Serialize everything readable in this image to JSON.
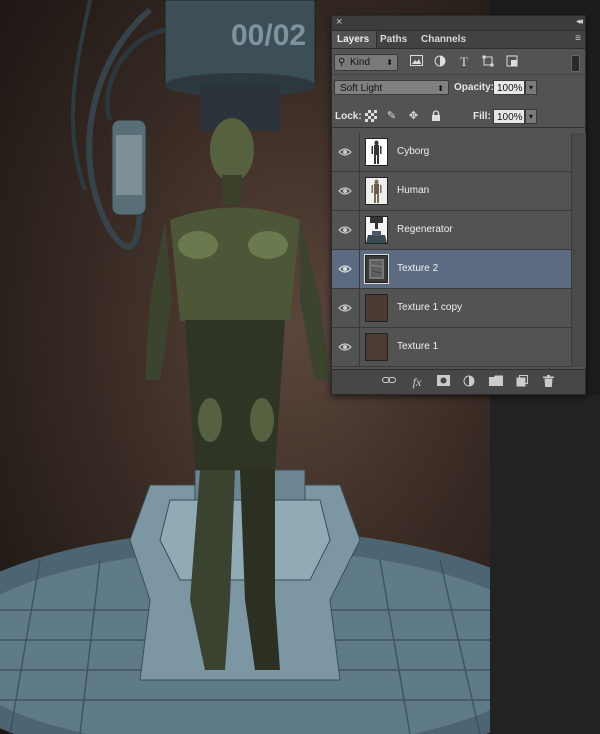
{
  "artwork": {
    "tank_label": "00/02"
  },
  "panel": {
    "close_glyph": "×",
    "collapse_glyph": "◂◂",
    "tabs": [
      {
        "label": "Layers",
        "active": true
      },
      {
        "label": "Paths",
        "active": false
      },
      {
        "label": "Channels",
        "active": false
      }
    ],
    "menu_glyph": "≡",
    "filter": {
      "kind_label": "Kind",
      "icons": [
        "image-filter-icon",
        "adjustment-filter-icon",
        "type-filter-icon",
        "shape-filter-icon",
        "smart-object-filter-icon"
      ]
    },
    "blend_mode": "Soft Light",
    "opacity_label": "Opacity:",
    "opacity_value": "100%",
    "lock_label": "Lock:",
    "fill_label": "Fill:",
    "fill_value": "100%",
    "layers": [
      {
        "name": "Cyborg",
        "selected": false,
        "thumb": "figure"
      },
      {
        "name": "Human",
        "selected": false,
        "thumb": "figure"
      },
      {
        "name": "Regenerator",
        "selected": false,
        "thumb": "machine"
      },
      {
        "name": "Texture 2",
        "selected": true,
        "thumb": "texture"
      },
      {
        "name": "Texture 1 copy",
        "selected": false,
        "thumb": "brown"
      },
      {
        "name": "Texture 1",
        "selected": false,
        "thumb": "brown"
      }
    ],
    "footer_icons": [
      "link-layers-icon",
      "fx-icon",
      "add-mask-icon",
      "adjustment-layer-icon",
      "new-group-icon",
      "new-layer-icon",
      "trash-icon"
    ]
  },
  "colors": {
    "panel_bg": "#535353",
    "selected_row": "#5d6b82"
  }
}
